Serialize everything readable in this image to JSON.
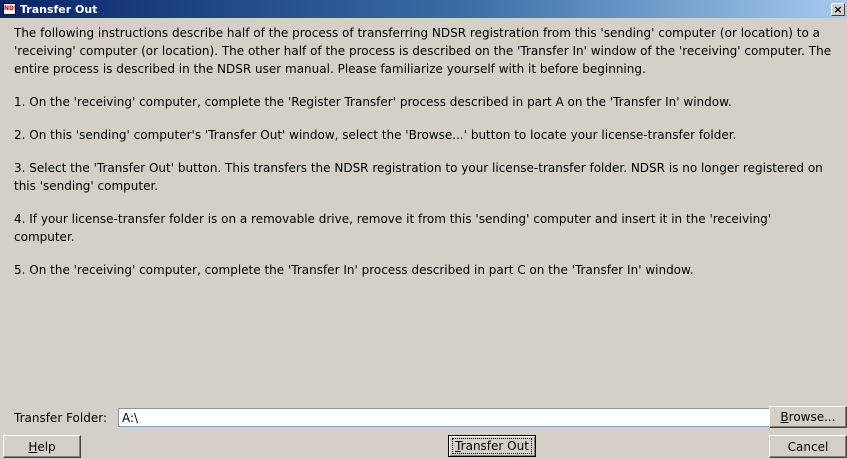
{
  "window": {
    "title": "Transfer Out",
    "icon": "ndsr-app-icon",
    "icon_text": "NDSR",
    "close_glyph": "×"
  },
  "instructions": {
    "intro": "The following instructions describe half of the process of transferring NDSR registration from this 'sending' computer (or location) to a 'receiving' computer (or location). The other half of the process is described on the 'Transfer In' window of the 'receiving' computer. The entire process is described in the NDSR user manual. Please familiarize yourself with it before beginning.",
    "steps": [
      "1. On the 'receiving' computer, complete the 'Register Transfer' process described in part A on the 'Transfer In' window.",
      "2. On this 'sending' computer's 'Transfer Out' window, select the 'Browse...' button to locate your license-transfer folder.",
      "3. Select the 'Transfer Out' button. This transfers the NDSR registration to your license-transfer folder. NDSR is no longer registered on this 'sending' computer.",
      "4. If your license-transfer folder is on a removable drive, remove it from this 'sending' computer and insert it in the 'receiving' computer.",
      "5. On the 'receiving' computer, complete the 'Transfer In' process described in part C on the 'Transfer In' window."
    ]
  },
  "folder": {
    "label": "Transfer Folder:",
    "value": "A:\\"
  },
  "buttons": {
    "browse_mnemonic": "B",
    "browse_rest": "rowse...",
    "help_mnemonic": "H",
    "help_rest": "elp",
    "transfer_mnemonic": "T",
    "transfer_rest": "ransfer Out",
    "cancel": "Cancel"
  }
}
